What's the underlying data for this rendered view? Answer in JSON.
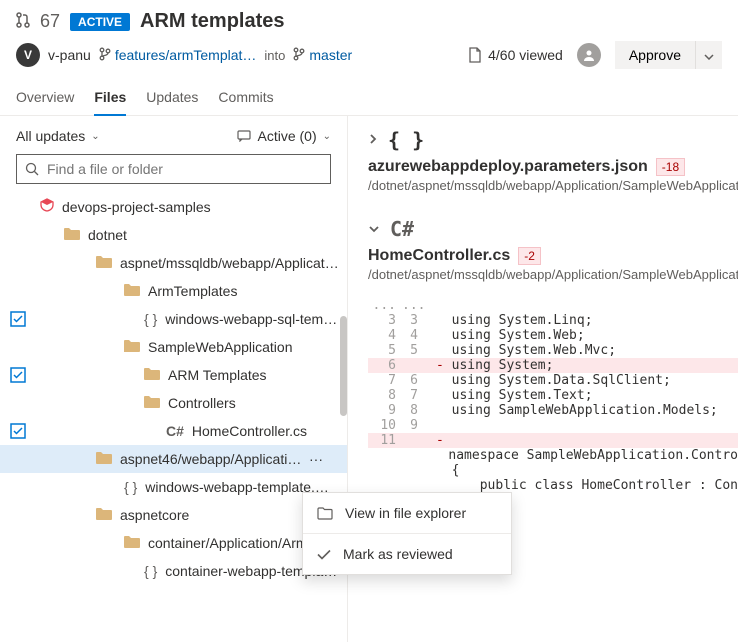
{
  "pr": {
    "number": "67",
    "status": "ACTIVE",
    "title": "ARM templates"
  },
  "user": {
    "initial": "V",
    "name": "v-panu"
  },
  "branch": {
    "source": "features/armTemplat…",
    "into": "into",
    "target": "master"
  },
  "viewed": {
    "label": "4/60 viewed"
  },
  "approve": {
    "label": "Approve"
  },
  "tabs": {
    "overview": "Overview",
    "files": "Files",
    "updates": "Updates",
    "commits": "Commits"
  },
  "filters": {
    "all_updates": "All updates",
    "active_count": "Active (0)"
  },
  "search": {
    "placeholder": "Find a file or folder"
  },
  "tree": {
    "repo": "devops-project-samples",
    "dotnet": "dotnet",
    "aspnet": "aspnet/mssqldb/webapp/Applicati…",
    "armtemplates1": "ArmTemplates",
    "file1": "windows-webapp-sql-temp…",
    "sampleapp": "SampleWebApplication",
    "armtemplates2": "ARM Templates",
    "controllers": "Controllers",
    "homecontroller": "HomeController.cs",
    "aspnet46": "aspnet46/webapp/Applicatio…",
    "file2": "windows-webapp-template.…",
    "aspnetcore": "aspnetcore",
    "container": "container/Application/ArmT…",
    "file3": "container-webapp-templat…"
  },
  "files": {
    "f1": {
      "name": "azurewebappdeploy.parameters.json",
      "diff": "-18",
      "path": "/dotnet/aspnet/mssqldb/webapp/Application/SampleWebApplicat"
    },
    "f2": {
      "name": "HomeController.cs",
      "diff": "-2",
      "path": "/dotnet/aspnet/mssqldb/webapp/Application/SampleWebApplicat"
    }
  },
  "code": {
    "dots": "...",
    "l3": "using System.Linq;",
    "l4": "using System.Web;",
    "l5": "using System.Web.Mvc;",
    "l6": "using System;",
    "l7": "using System.Data.SqlClient;",
    "l8": "using System.Text;",
    "l9": "using SampleWebApplication.Models;",
    "l12": "namespace SampleWebApplication.Contro",
    "l13": "{",
    "l14": "    public class HomeController : Con"
  },
  "ln": {
    "3": "3",
    "4": "4",
    "5": "5",
    "6": "6",
    "7": "7",
    "8": "8",
    "9": "9",
    "10": "10",
    "11": "11"
  },
  "menu": {
    "view": "View in file explorer",
    "mark": "Mark as reviewed"
  }
}
